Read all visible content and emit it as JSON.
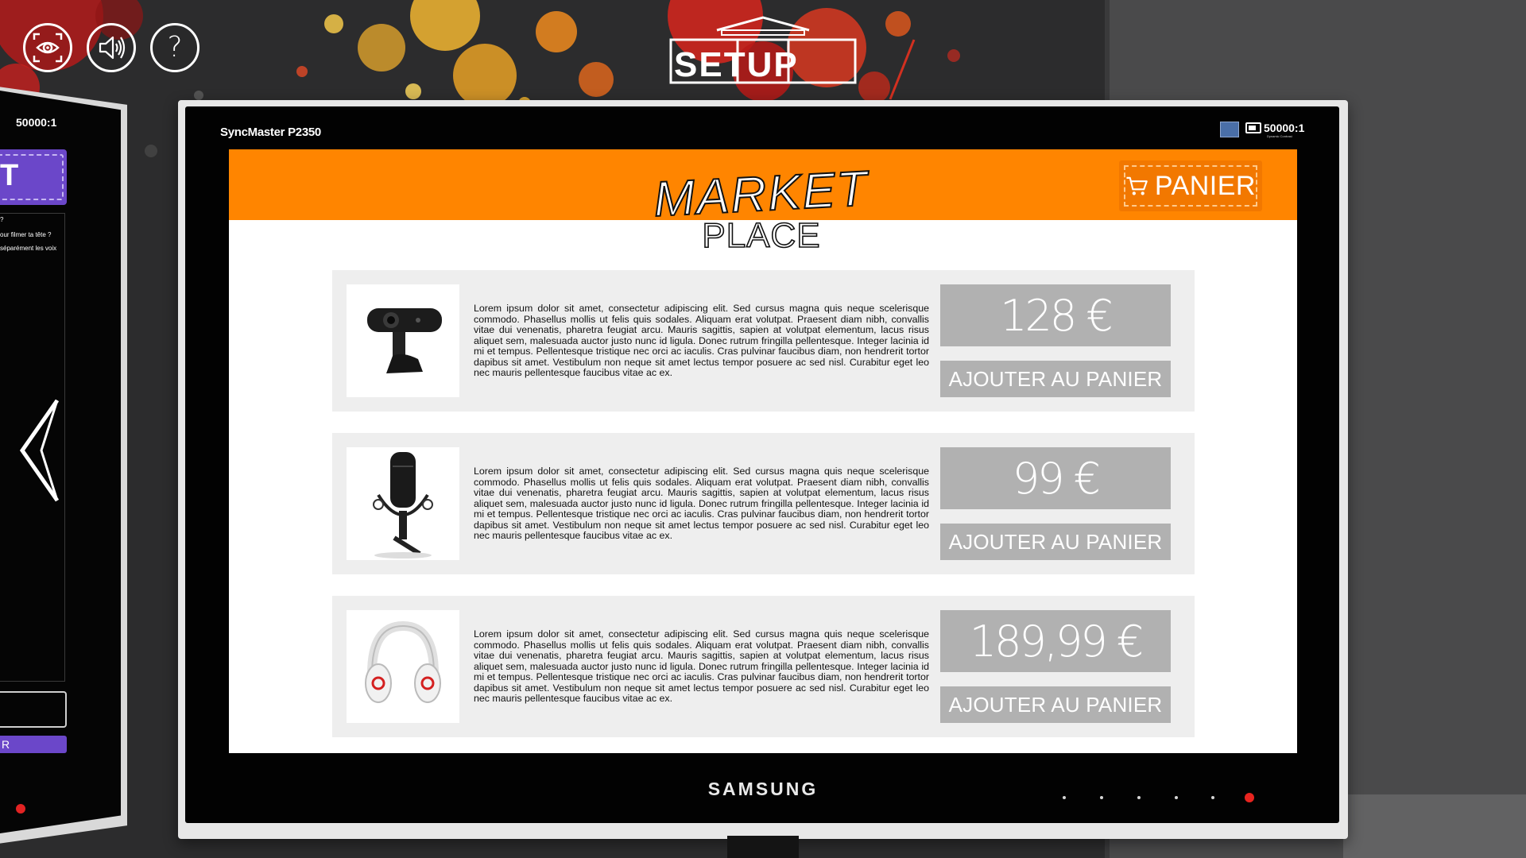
{
  "hud": {
    "view_icon": "eye-fullscreen-icon",
    "sound_icon": "speaker-icon",
    "help_label": "?"
  },
  "logo": {
    "text": "SETUP"
  },
  "left_monitor": {
    "contrast": "50000:1",
    "big_letter": "T",
    "line1": "?",
    "line2": "our filmer ta tête ?",
    "line3": "séparément les voix",
    "bar_text": "R",
    "arrow_icon": "chevron-left-icon"
  },
  "monitor": {
    "model": "SyncMaster P2350",
    "contrast": "50000:1",
    "contrast_sub": "Dynamic Contrast",
    "brand": "SAMSUNG"
  },
  "store": {
    "logo_line1": "MARKET",
    "logo_line2": "PLACE",
    "cart_label": "PANIER",
    "cart_icon": "shopping-cart-icon",
    "products": [
      {
        "image_icon": "webcam-icon",
        "description": "Lorem ipsum dolor sit amet, consectetur adipiscing elit. Sed cursus magna quis neque scelerisque commodo. Phasellus mollis ut felis quis sodales. Aliquam erat volutpat. Praesent diam nibh, convallis vitae dui venenatis, pharetra feugiat arcu. Mauris sagittis, sapien at volutpat elementum, lacus risus aliquet sem, malesuada auctor justo nunc id ligula. Donec rutrum fringilla pellentesque. Integer lacinia id mi et tempus. Pellentesque tristique nec orci ac iaculis. Cras pulvinar faucibus diam, non hendrerit tortor dapibus sit amet. Vestibulum non neque sit amet lectus tempor posuere ac sed nisl. Curabitur eget leo nec mauris pellentesque faucibus vitae ac ex.",
        "price": "128 €",
        "add_label": "AJOUTER AU PANIER"
      },
      {
        "image_icon": "microphone-icon",
        "description": "Lorem ipsum dolor sit amet, consectetur adipiscing elit. Sed cursus magna quis neque scelerisque commodo. Phasellus mollis ut felis quis sodales. Aliquam erat volutpat. Praesent diam nibh, convallis vitae dui venenatis, pharetra feugiat arcu. Mauris sagittis, sapien at volutpat elementum, lacus risus aliquet sem, malesuada auctor justo nunc id ligula. Donec rutrum fringilla pellentesque. Integer lacinia id mi et tempus. Pellentesque tristique nec orci ac iaculis. Cras pulvinar faucibus diam, non hendrerit tortor dapibus sit amet. Vestibulum non neque sit amet lectus tempor posuere ac sed nisl. Curabitur eget leo nec mauris pellentesque faucibus vitae ac ex.",
        "price": "99 €",
        "add_label": "AJOUTER AU PANIER"
      },
      {
        "image_icon": "headphones-icon",
        "description": "Lorem ipsum dolor sit amet, consectetur adipiscing elit. Sed cursus magna quis neque scelerisque commodo. Phasellus mollis ut felis quis sodales. Aliquam erat volutpat. Praesent diam nibh, convallis vitae dui venenatis, pharetra feugiat arcu. Mauris sagittis, sapien at volutpat elementum, lacus risus aliquet sem, malesuada auctor justo nunc id ligula. Donec rutrum fringilla pellentesque. Integer lacinia id mi et tempus. Pellentesque tristique nec orci ac iaculis. Cras pulvinar faucibus diam, non hendrerit tortor dapibus sit amet. Vestibulum non neque sit amet lectus tempor posuere ac sed nisl. Curabitur eget leo nec mauris pellentesque faucibus vitae ac ex.",
        "price": "189,99 €",
        "add_label": "AJOUTER AU PANIER"
      }
    ]
  },
  "colors": {
    "header_orange": "#ff8500",
    "button_gray": "#b1b1b1",
    "card_gray": "#eeeeee",
    "accent_purple": "#6b47c9",
    "power_led_red": "#e8241f"
  }
}
